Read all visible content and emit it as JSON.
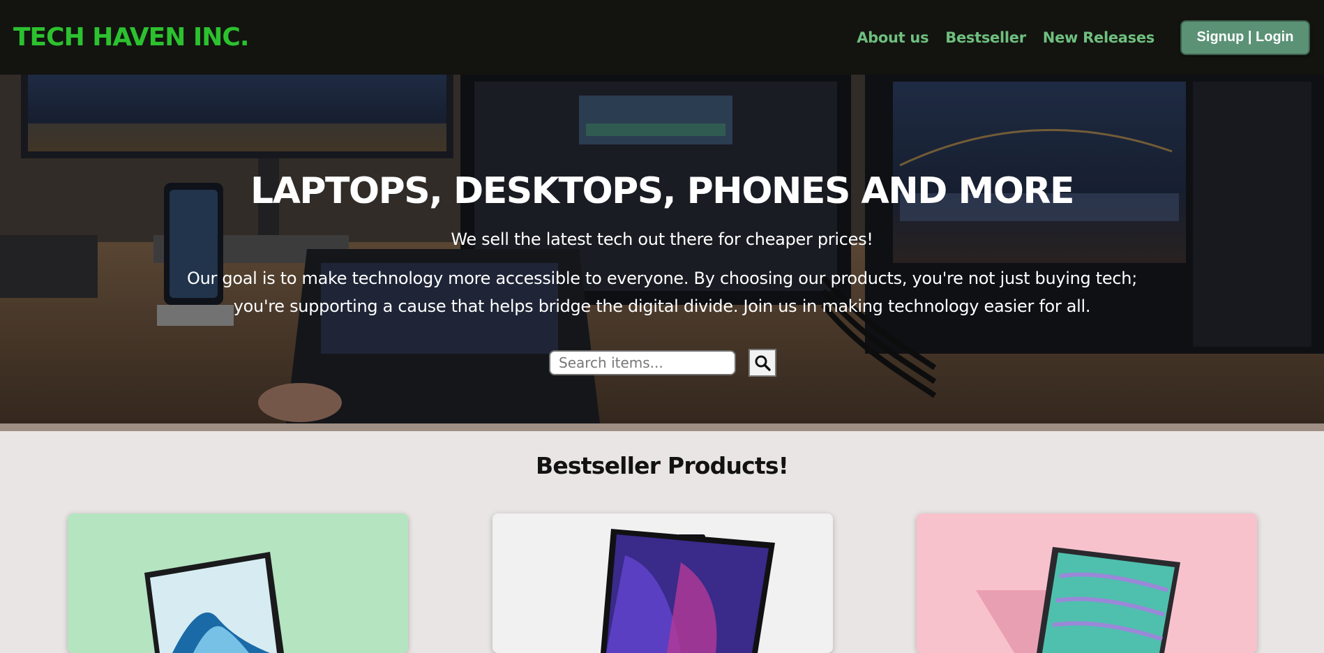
{
  "brand": {
    "name": "TECH HAVEN INC.",
    "color": "#2cc12f"
  },
  "nav": {
    "links": [
      "About us",
      "Bestseller",
      "New Releases"
    ],
    "auth_label": "Signup | Login",
    "link_color": "#6fbf7f",
    "auth_bg": "#5b9276"
  },
  "hero": {
    "title": "LAPTOPS, DESKTOPS, PHONES AND MORE",
    "subtitle": "We sell the latest tech out there for cheaper prices!",
    "description": "Our goal is to make technology more accessible to everyone. By choosing our products, you're not just buying tech; you're supporting a cause that helps bridge the digital divide. Join us in making technology easier for all.",
    "search": {
      "placeholder": "Search items...",
      "icon": "search-icon"
    }
  },
  "products": {
    "heading": "Bestseller Products!",
    "cards": [
      {
        "image": "laptop-on-green-background",
        "bg": "#b5e4c0"
      },
      {
        "image": "laptop-on-white-background",
        "bg": "#f1f1f1"
      },
      {
        "image": "laptop-on-pink-background",
        "bg": "#f8c2cd"
      }
    ]
  }
}
